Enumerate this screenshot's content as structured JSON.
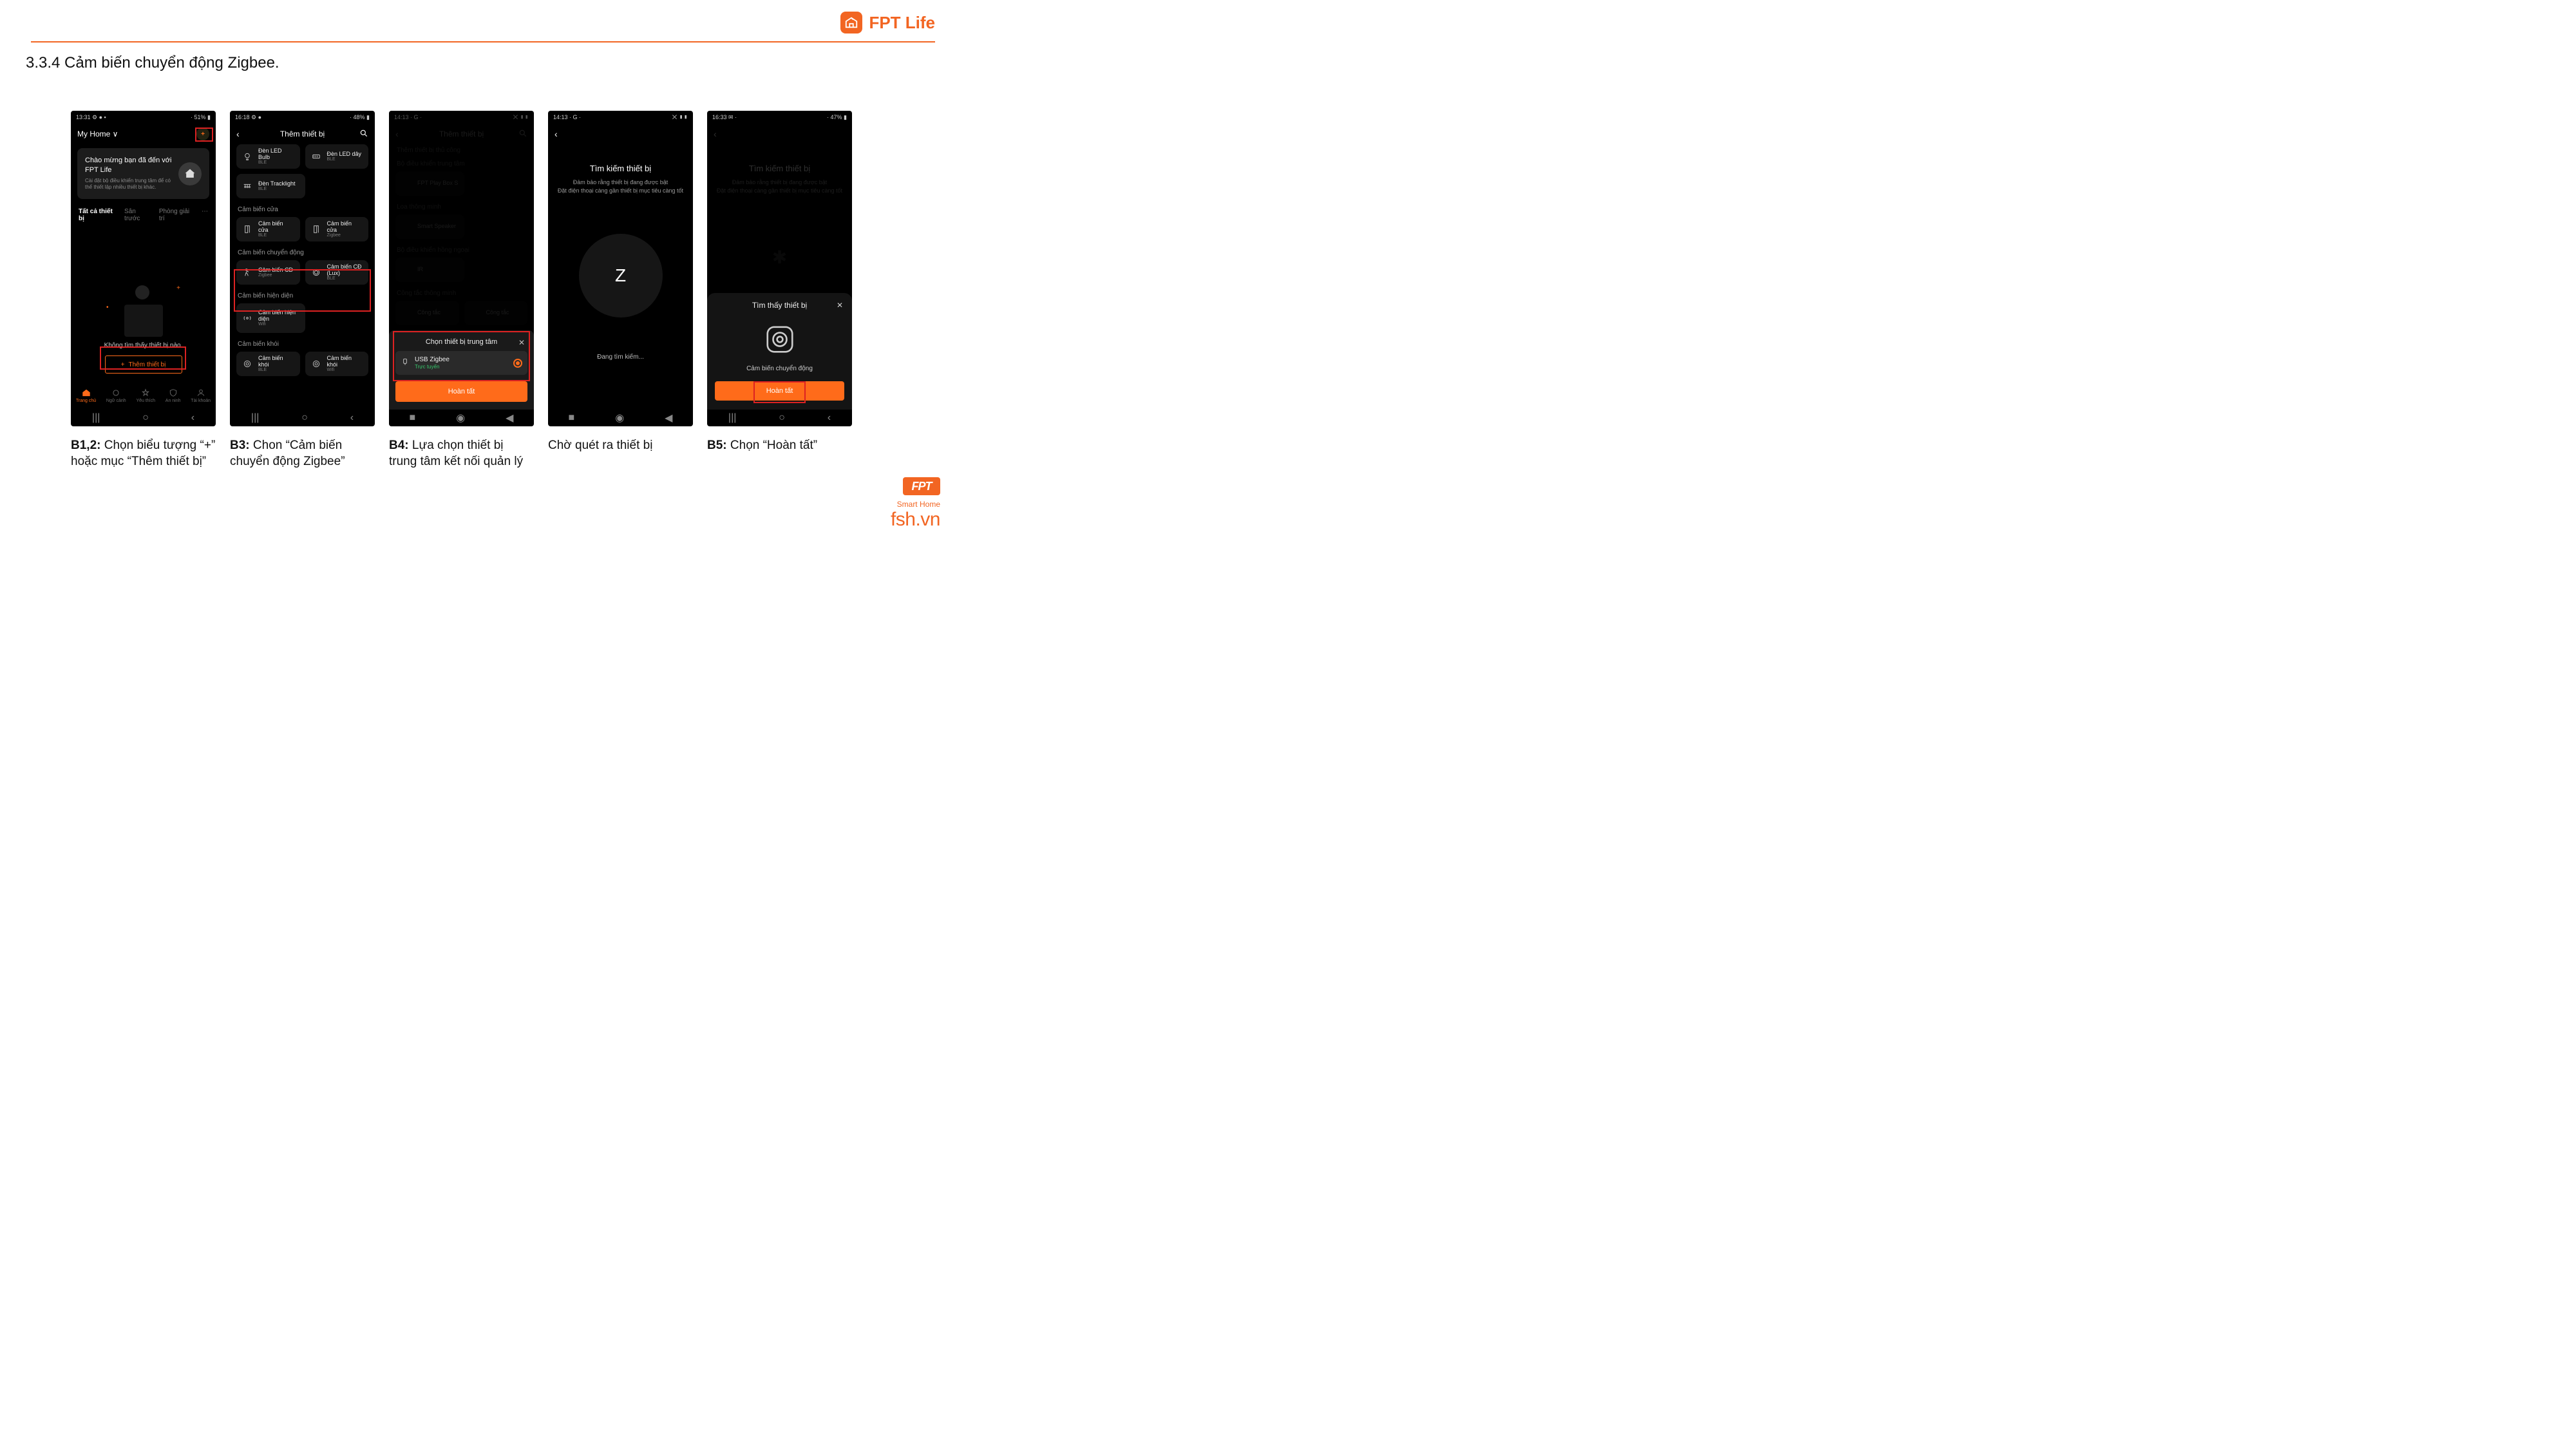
{
  "brand": {
    "name": "FPT Life"
  },
  "section_title": "3.3.4 Cảm biến chuyển động Zigbee.",
  "footer": {
    "smart": "Smart Home",
    "url": "fsh.vn",
    "logo": "FPT"
  },
  "p1": {
    "status_left": "13:31 ⚙ ● ▪",
    "status_right": "· 51% ▮",
    "home": "My Home  ∨",
    "card_title": "Chào mừng bạn đã đến với FPT Life",
    "card_sub": "Cài đặt bộ điều khiển trung tâm để có thể thiết lập nhiều thiết bị khác.",
    "tab_all": "Tất cả thiết bị",
    "tab2": "Sân trước",
    "tab3": "Phòng giải trí",
    "empty": "Không tìm thấy thiết bị nào.",
    "add_btn": "Thêm thiết bị",
    "nav": {
      "home": "Trang chủ",
      "scene": "Ngữ cảnh",
      "fav": "Yêu thích",
      "sec": "An ninh",
      "acc": "Tài khoản"
    }
  },
  "cap1": {
    "b": "B1,2:",
    "t": " Chọn biểu tượng “+” hoặc mục “Thêm thiết bị”"
  },
  "p2": {
    "status_left": "16:18 ⚙ ●",
    "status_right": "· 48% ▮",
    "title": "Thêm thiết bị",
    "tiles": {
      "led_bulb": {
        "name": "Đèn LED Bulb",
        "sub": "BLE"
      },
      "led_strip": {
        "name": "Đèn LED dây",
        "sub": "BLE"
      },
      "track": {
        "name": "Đèn Tracklight",
        "sub": "BLE"
      }
    },
    "sect_door": "Cảm biến cửa",
    "door_ble": {
      "name": "Cảm biến cửa",
      "sub": "BLE"
    },
    "door_zig": {
      "name": "Cảm biến cửa",
      "sub": "Zigbee"
    },
    "sect_motion": "Cảm biến chuyển động",
    "mot_zig": {
      "name": "Cảm biến CĐ",
      "sub": "Zigbee"
    },
    "mot_lux": {
      "name": "Cảm biến CĐ (Lux)",
      "sub": "BLE"
    },
    "sect_pres": "Cảm biến hiện diện",
    "pres": {
      "name": "Cảm biến hiện diện",
      "sub": "Wifi"
    },
    "sect_smoke": "Cảm biến khói",
    "smoke_ble": {
      "name": "Cảm biến khói",
      "sub": "BLE"
    },
    "smoke_wifi": {
      "name": "Cảm biến khói",
      "sub": "Wifi"
    }
  },
  "cap2": {
    "b": "B3:",
    "t": " Chon “Cảm biến chuyển động Zigbee”"
  },
  "p3": {
    "status_left": "14:13 · G ·",
    "status_right": "⨉ ▮▮",
    "bg_title": "Thêm thiết bị",
    "bg_sect1": "Thêm thiết bị thủ công",
    "bg_sect2": "Bộ điều khiển trung tâm",
    "bg_item1": "FPT Play Box S",
    "bg_sect3": "Loa thông minh",
    "bg_item2": "Smart Speaker",
    "bg_sect4": "Bộ điều khiển hồng ngoại",
    "bg_item3": "IR",
    "bg_sect5": "Công tắc thông minh",
    "bg_item4a": "Công tắc",
    "bg_item4b": "Công tắc",
    "sheet_title": "Chọn thiết bị trung tâm",
    "hub_name": "USB Zigbee",
    "hub_status": "Trực tuyến",
    "done": "Hoàn tất"
  },
  "cap3": {
    "b": "B4:",
    "t": " Lựa chọn thiết bị trung tâm kết nối quản lý"
  },
  "p4": {
    "status_left": "14:13 · G ·",
    "status_right": "⨉ ▮▮",
    "title": "Tìm kiếm thiết bị",
    "sub1": "Đảm bảo rằng thiết bị đang được bật",
    "sub2": "Đặt điện thoại càng gần thiết bị mục tiêu càng tốt",
    "letter": "Z",
    "scanning": "Đang tìm kiếm..."
  },
  "cap4": {
    "t": "Chờ quét ra thiết bị"
  },
  "p5": {
    "status_left": "16:33 ✉ ·",
    "status_right": "· 47% ▮",
    "bg_title": "Tìm kiếm thiết bị",
    "bg_sub1": "Đảm bảo rằng thiết bị đang được bật",
    "bg_sub2": "Đặt điện thoại càng gần thiết bị mục tiêu càng tốt",
    "sheet_title": "Tìm thấy thiết bị",
    "dev_name": "Cảm biến chuyển động",
    "done": "Hoàn tất"
  },
  "cap5": {
    "b": "B5:",
    "t": " Chọn “Hoàn tất”"
  }
}
